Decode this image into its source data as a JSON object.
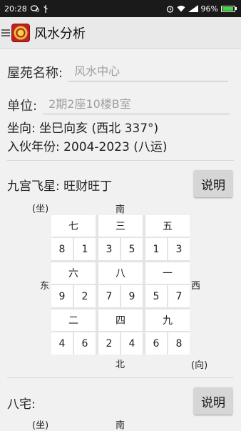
{
  "status_bar": {
    "time": "20:28",
    "battery": "96%",
    "battery_level": 0.96
  },
  "app": {
    "title": "风水分析"
  },
  "form": {
    "name_label": "屋苑名称:",
    "name_placeholder": "风水中心",
    "unit_label": "单位:",
    "unit_placeholder": "2期2座10楼B室"
  },
  "info": {
    "facing": "坐向: 坐巳向亥 (西北 337°)",
    "period": "入伙年份: 2004-2023 (八运)"
  },
  "flying_star": {
    "title": "九宫飞星: 旺财旺丁",
    "button_label": "说明",
    "labels": {
      "sit": "(坐)",
      "face": "(向)",
      "south": "南",
      "north": "北",
      "east": "东",
      "west": "西"
    },
    "cells": [
      {
        "star": "七",
        "left": "8",
        "right": "1"
      },
      {
        "star": "三",
        "left": "3",
        "right": "5"
      },
      {
        "star": "五",
        "left": "1",
        "right": "3"
      },
      {
        "star": "六",
        "left": "9",
        "right": "2"
      },
      {
        "star": "八",
        "left": "7",
        "right": "9"
      },
      {
        "star": "一",
        "left": "5",
        "right": "7"
      },
      {
        "star": "二",
        "left": "4",
        "right": "6"
      },
      {
        "star": "四",
        "left": "2",
        "right": "4"
      },
      {
        "star": "九",
        "left": "6",
        "right": "8"
      }
    ]
  },
  "ba_zhai": {
    "title": "八宅:",
    "button_label": "说明",
    "labels": {
      "sit": "(坐)",
      "south": "南"
    }
  },
  "colors": {
    "status_bar_bg": "#1a1a1a",
    "app_bar_bg": "#e9e9e9",
    "page_bg": "#f1f1f1",
    "battery_fill": "#3ddc3d"
  }
}
